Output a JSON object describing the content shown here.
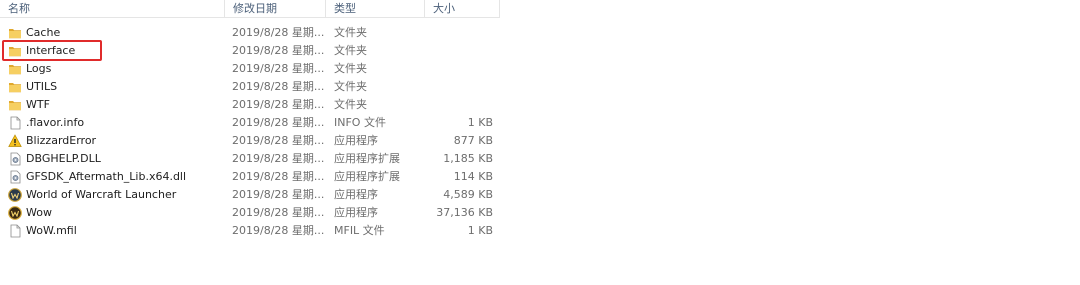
{
  "columns": {
    "name": "名称",
    "date": "修改日期",
    "type": "类型",
    "size": "大小"
  },
  "files": [
    {
      "name": "Cache",
      "date": "2019/8/28 星期...",
      "type": "文件夹",
      "size": "",
      "icon": "folder-icon"
    },
    {
      "name": "Interface",
      "date": "2019/8/28 星期...",
      "type": "文件夹",
      "size": "",
      "icon": "folder-icon",
      "highlighted": true
    },
    {
      "name": "Logs",
      "date": "2019/8/28 星期...",
      "type": "文件夹",
      "size": "",
      "icon": "folder-icon"
    },
    {
      "name": "UTILS",
      "date": "2019/8/28 星期...",
      "type": "文件夹",
      "size": "",
      "icon": "folder-icon"
    },
    {
      "name": "WTF",
      "date": "2019/8/28 星期...",
      "type": "文件夹",
      "size": "",
      "icon": "folder-icon"
    },
    {
      "name": ".flavor.info",
      "date": "2019/8/28 星期...",
      "type": "INFO 文件",
      "size": "1 KB",
      "icon": "file-icon"
    },
    {
      "name": "BlizzardError",
      "date": "2019/8/28 星期...",
      "type": "应用程序",
      "size": "877 KB",
      "icon": "warning-icon"
    },
    {
      "name": "DBGHELP.DLL",
      "date": "2019/8/28 星期...",
      "type": "应用程序扩展",
      "size": "1,185 KB",
      "icon": "dll-icon"
    },
    {
      "name": "GFSDK_Aftermath_Lib.x64.dll",
      "date": "2019/8/28 星期...",
      "type": "应用程序扩展",
      "size": "114 KB",
      "icon": "dll-icon"
    },
    {
      "name": "World of Warcraft Launcher",
      "date": "2019/8/28 星期...",
      "type": "应用程序",
      "size": "4,589 KB",
      "icon": "wow-launcher-icon"
    },
    {
      "name": "Wow",
      "date": "2019/8/28 星期...",
      "type": "应用程序",
      "size": "37,136 KB",
      "icon": "wow-icon"
    },
    {
      "name": "WoW.mfil",
      "date": "2019/8/28 星期...",
      "type": "MFIL 文件",
      "size": "1 KB",
      "icon": "file-icon"
    }
  ],
  "colors": {
    "highlight_border": "#e02b2b",
    "folder": "#f2c250",
    "header_text": "#4c607a"
  }
}
